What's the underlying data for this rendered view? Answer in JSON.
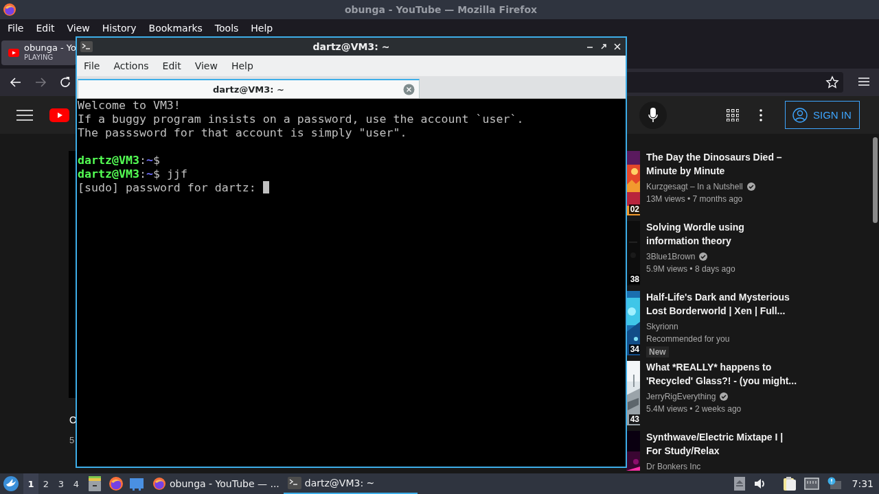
{
  "browser": {
    "title": "obunga - YouTube — Mozilla Firefox",
    "menu": [
      "File",
      "Edit",
      "View",
      "History",
      "Bookmarks",
      "Tools",
      "Help"
    ],
    "tabs": [
      {
        "label": "obunga - Yo",
        "status": "PLAYING",
        "selected": true
      }
    ],
    "youtube": {
      "sign_in": "SIGN IN",
      "video_title_fragment": "O",
      "video_meta_fragment": "5",
      "recommendations": [
        {
          "title": "The Day the Dinosaurs Died – Minute by Minute",
          "channel": "Kurzgesagt – In a Nutshell",
          "verified": true,
          "meta": "13M views • 7 months ago",
          "duration": "02"
        },
        {
          "title": "Solving Wordle using information theory",
          "channel": "3Blue1Brown",
          "verified": true,
          "meta": "5.9M views • 8 days ago",
          "duration": "38"
        },
        {
          "title": "Half-Life's Dark and Mysterious Lost Borderworld | Xen | Full...",
          "channel": "Skyrionn",
          "verified": false,
          "meta": "Recommended for you",
          "badge": "New",
          "duration": "34"
        },
        {
          "title": "What *REALLY* happens to 'Recycled' Glass?! - (you might...",
          "channel": "JerryRigEverything",
          "verified": true,
          "meta": "5.4M views • 2 weeks ago",
          "duration": "43"
        },
        {
          "title": "Synthwave/Electric Mixtape I | For Study/Relax",
          "channel": "Dr Bonkers Inc",
          "verified": false
        }
      ]
    }
  },
  "terminal": {
    "title": "dartz@VM3: ~",
    "menu": [
      "File",
      "Actions",
      "Edit",
      "View",
      "Help"
    ],
    "tabs": [
      {
        "label": "dartz@VM3: ~",
        "selected": true
      }
    ],
    "lines": [
      {
        "kind": "text",
        "text": "Welcome to VM3!"
      },
      {
        "kind": "text",
        "text": "If a buggy program insists on a password, use the account `user`."
      },
      {
        "kind": "text",
        "text": "The passsword for that account is simply \"user\"."
      },
      {
        "kind": "blank"
      },
      {
        "kind": "prompt",
        "user": "dartz@VM3",
        "sep": ":",
        "path": "~",
        "sign": "$"
      },
      {
        "kind": "prompt",
        "user": "dartz@VM3",
        "sep": ":",
        "path": "~",
        "sign": "$",
        "command": "jjf"
      },
      {
        "kind": "text",
        "text": "[sudo] password for dartz:",
        "cursor": true
      }
    ]
  },
  "taskbar": {
    "workspaces": [
      {
        "label": "1",
        "selected": true
      },
      {
        "label": "2",
        "selected": false
      },
      {
        "label": "3",
        "selected": false
      },
      {
        "label": "4",
        "selected": false
      }
    ],
    "tasks": [
      {
        "kind": "browser",
        "label": "obunga - YouTube — ...",
        "selected": false
      },
      {
        "kind": "terminal",
        "label": "dartz@VM3: ~",
        "selected": true
      }
    ],
    "clock": "7:31"
  }
}
